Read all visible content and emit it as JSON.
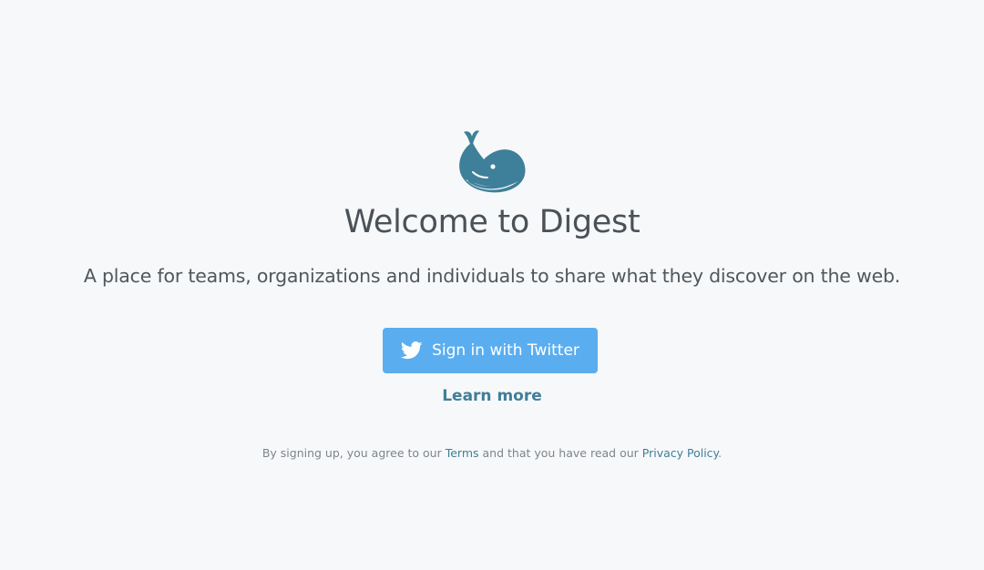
{
  "brand": {
    "logo_icon": "whale-icon",
    "logo_color": "#3e8099"
  },
  "header": {
    "title": "Welcome to Digest",
    "tagline": "A place for teams, organizations and individuals to share what they discover on the web."
  },
  "actions": {
    "twitter_icon": "twitter-bird-icon",
    "twitter_button_label": "Sign in with Twitter",
    "twitter_button_color": "#5aaef0",
    "learn_more_label": "Learn more"
  },
  "legal": {
    "prefix": "By signing up, you agree to our",
    "terms_link": "Terms",
    "middle": "and that you have read our",
    "privacy_link": "Privacy Policy",
    "suffix": "."
  }
}
